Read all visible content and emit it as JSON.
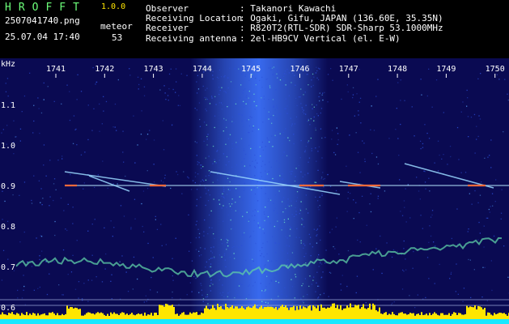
{
  "header": {
    "app_name": "HROFFT",
    "version": "1.0.0",
    "filename": "2507041740.png",
    "timestamp": "25.07.04 17:40",
    "meteor_label": "meteor",
    "meteor_count": "53",
    "info": [
      {
        "key": "Observer",
        "value": "Takanori Kawachi"
      },
      {
        "key": "Receiving Location",
        "value": "Ogaki, Gifu, JAPAN (136.60E, 35.35N)"
      },
      {
        "key": "Receiver",
        "value": "R820T2(RTL-SDR) SDR-Sharp 53.1000MHz"
      },
      {
        "key": "Receiving antenna",
        "value": "2el-HB9CV Vertical (el. E-W)"
      }
    ]
  },
  "chart_data": {
    "type": "heatmap",
    "ylabel": "kHz",
    "x_ticks": [
      "1741",
      "1742",
      "1743",
      "1744",
      "1745",
      "1746",
      "1747",
      "1748",
      "1749",
      "1750"
    ],
    "y_ticks": [
      "1.1",
      "1.0",
      "0.9",
      "0.8",
      "0.7",
      "0.6"
    ],
    "colors": {
      "background": "#0a0a52",
      "noise": "#3d74ff",
      "signal": "#ff6a3a",
      "baseline": "#ffe600",
      "spectrum": "#19e8ff"
    }
  }
}
